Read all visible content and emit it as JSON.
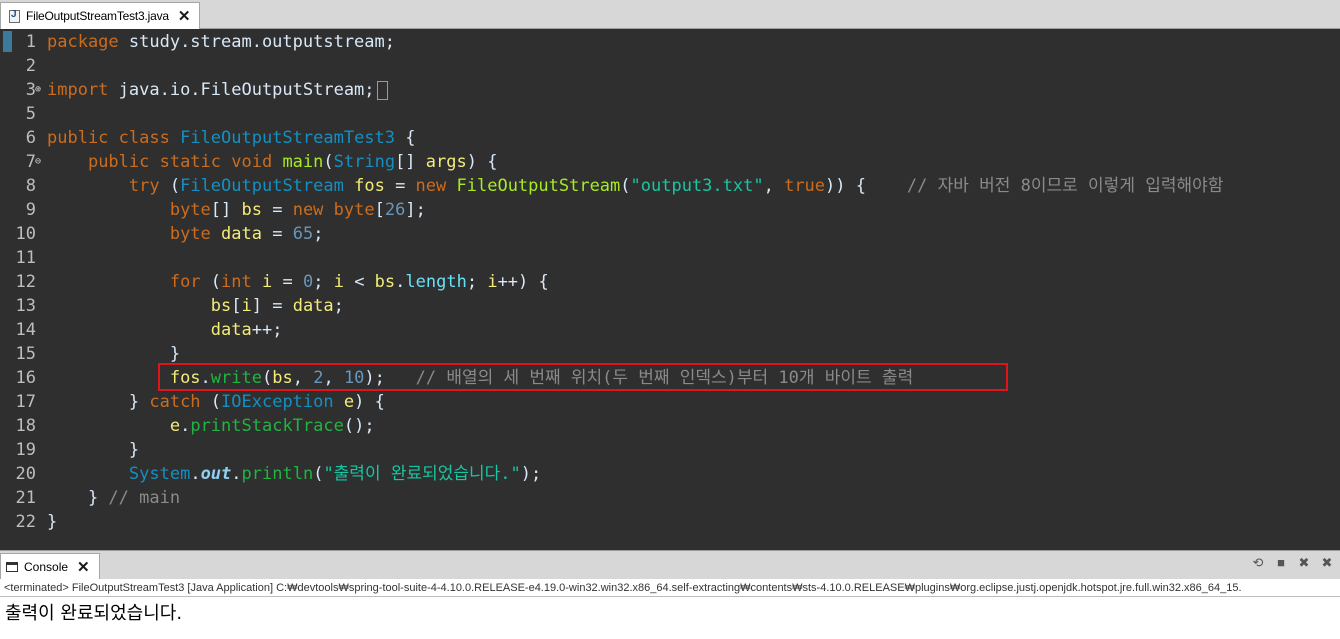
{
  "editor_tab": {
    "title": "FileOutputStreamTest3.java",
    "close": "✕",
    "icon": "java-file-icon"
  },
  "editor": {
    "lines": [
      {
        "n": "1",
        "fold": "",
        "segs": [
          {
            "t": "package",
            "c": "kw"
          },
          {
            "t": " study.stream.outputstream;"
          }
        ]
      },
      {
        "n": "2",
        "fold": "",
        "segs": []
      },
      {
        "n": "3",
        "fold": "⊕",
        "segs": [
          {
            "t": "import",
            "c": "kw"
          },
          {
            "t": " java.io.FileOutputStream;"
          },
          {
            "box": true
          }
        ]
      },
      {
        "n": "5",
        "fold": "",
        "segs": []
      },
      {
        "n": "6",
        "fold": "",
        "segs": [
          {
            "t": "public class",
            "c": "kw"
          },
          {
            "t": " "
          },
          {
            "t": "FileOutputStreamTest3",
            "c": "cls"
          },
          {
            "t": " {"
          }
        ]
      },
      {
        "n": "7",
        "fold": "⊖",
        "segs": [
          {
            "t": "    "
          },
          {
            "t": "public static void",
            "c": "kw"
          },
          {
            "t": " "
          },
          {
            "t": "main",
            "c": "fn"
          },
          {
            "t": "("
          },
          {
            "t": "String",
            "c": "cls"
          },
          {
            "t": "[] "
          },
          {
            "t": "args",
            "c": "var"
          },
          {
            "t": ") {"
          }
        ]
      },
      {
        "n": "8",
        "fold": "",
        "segs": [
          {
            "t": "        "
          },
          {
            "t": "try",
            "c": "kw"
          },
          {
            "t": " ("
          },
          {
            "t": "FileOutputStream",
            "c": "cls"
          },
          {
            "t": " "
          },
          {
            "t": "fos",
            "c": "var"
          },
          {
            "t": " = "
          },
          {
            "t": "new",
            "c": "kw"
          },
          {
            "t": " "
          },
          {
            "t": "FileOutputStream",
            "c": "fn"
          },
          {
            "t": "("
          },
          {
            "t": "\"output3.txt\"",
            "c": "str"
          },
          {
            "t": ", "
          },
          {
            "t": "true",
            "c": "kw"
          },
          {
            "t": ")) {    "
          },
          {
            "t": "// 자바 버전 8이므로 이렇게 입력해야함",
            "c": "cmt"
          }
        ]
      },
      {
        "n": "9",
        "fold": "",
        "segs": [
          {
            "t": "            "
          },
          {
            "t": "byte",
            "c": "kw"
          },
          {
            "t": "[] "
          },
          {
            "t": "bs",
            "c": "var"
          },
          {
            "t": " = "
          },
          {
            "t": "new",
            "c": "kw"
          },
          {
            "t": " "
          },
          {
            "t": "byte",
            "c": "kw"
          },
          {
            "t": "["
          },
          {
            "t": "26",
            "c": "num"
          },
          {
            "t": "];"
          }
        ]
      },
      {
        "n": "10",
        "fold": "",
        "segs": [
          {
            "t": "            "
          },
          {
            "t": "byte",
            "c": "kw"
          },
          {
            "t": " "
          },
          {
            "t": "data",
            "c": "var"
          },
          {
            "t": " = "
          },
          {
            "t": "65",
            "c": "num"
          },
          {
            "t": ";"
          }
        ]
      },
      {
        "n": "11",
        "fold": "",
        "segs": []
      },
      {
        "n": "12",
        "fold": "",
        "segs": [
          {
            "t": "            "
          },
          {
            "t": "for",
            "c": "kw"
          },
          {
            "t": " ("
          },
          {
            "t": "int",
            "c": "kw"
          },
          {
            "t": " "
          },
          {
            "t": "i",
            "c": "var"
          },
          {
            "t": " = "
          },
          {
            "t": "0",
            "c": "num"
          },
          {
            "t": "; "
          },
          {
            "t": "i",
            "c": "var"
          },
          {
            "t": " < "
          },
          {
            "t": "bs",
            "c": "var"
          },
          {
            "t": "."
          },
          {
            "t": "length",
            "c": "fld"
          },
          {
            "t": "; "
          },
          {
            "t": "i",
            "c": "var"
          },
          {
            "t": "++) {"
          }
        ]
      },
      {
        "n": "13",
        "fold": "",
        "segs": [
          {
            "t": "                "
          },
          {
            "t": "bs",
            "c": "var"
          },
          {
            "t": "["
          },
          {
            "t": "i",
            "c": "var"
          },
          {
            "t": "] = "
          },
          {
            "t": "data",
            "c": "var"
          },
          {
            "t": ";"
          }
        ]
      },
      {
        "n": "14",
        "fold": "",
        "segs": [
          {
            "t": "                "
          },
          {
            "t": "data",
            "c": "var"
          },
          {
            "t": "++;"
          }
        ]
      },
      {
        "n": "15",
        "fold": "",
        "segs": [
          {
            "t": "            }"
          }
        ]
      },
      {
        "n": "16",
        "fold": "",
        "segs": [
          {
            "t": "            "
          },
          {
            "t": "fos",
            "c": "var"
          },
          {
            "t": "."
          },
          {
            "t": "write",
            "c": "mth"
          },
          {
            "t": "("
          },
          {
            "t": "bs",
            "c": "var"
          },
          {
            "t": ", "
          },
          {
            "t": "2",
            "c": "num"
          },
          {
            "t": ", "
          },
          {
            "t": "10",
            "c": "num"
          },
          {
            "t": ");   "
          },
          {
            "t": "// 배열의 세 번째 위치(두 번째 인덱스)부터 10개 바이트 출력",
            "c": "cmt"
          }
        ]
      },
      {
        "n": "17",
        "fold": "",
        "segs": [
          {
            "t": "        } "
          },
          {
            "t": "catch",
            "c": "kw"
          },
          {
            "t": " ("
          },
          {
            "t": "IOException",
            "c": "cls"
          },
          {
            "t": " "
          },
          {
            "t": "e",
            "c": "var"
          },
          {
            "t": ") {"
          }
        ]
      },
      {
        "n": "18",
        "fold": "",
        "segs": [
          {
            "t": "            "
          },
          {
            "t": "e",
            "c": "var"
          },
          {
            "t": "."
          },
          {
            "t": "printStackTrace",
            "c": "mth"
          },
          {
            "t": "();"
          }
        ]
      },
      {
        "n": "19",
        "fold": "",
        "segs": [
          {
            "t": "        }"
          }
        ]
      },
      {
        "n": "20",
        "fold": "",
        "segs": [
          {
            "t": "        "
          },
          {
            "t": "System",
            "c": "cls"
          },
          {
            "t": "."
          },
          {
            "t": "out",
            "c": "sfld"
          },
          {
            "t": "."
          },
          {
            "t": "println",
            "c": "mth"
          },
          {
            "t": "("
          },
          {
            "t": "\"출력이 완료되었습니다.\"",
            "c": "str"
          },
          {
            "t": ");"
          }
        ]
      },
      {
        "n": "21",
        "fold": "",
        "segs": [
          {
            "t": "    } "
          },
          {
            "t": "// main",
            "c": "cmt"
          }
        ]
      },
      {
        "n": "22",
        "fold": "",
        "segs": [
          {
            "t": "}"
          }
        ]
      }
    ],
    "scroll_arrow": "<"
  },
  "console": {
    "tab_label": "Console",
    "close": "✕",
    "tools": [
      {
        "name": "pin-console-icon",
        "glyph": "⟲"
      },
      {
        "name": "terminate-icon",
        "glyph": "■"
      },
      {
        "name": "remove-launch-icon",
        "glyph": "✖"
      },
      {
        "name": "remove-all-icon",
        "glyph": "✖"
      }
    ],
    "status": "<terminated> FileOutputStreamTest3 [Java Application] C:₩devtools₩spring-tool-suite-4-4.10.0.RELEASE-e4.19.0-win32.win32.x86_64.self-extracting₩contents₩sts-4.10.0.RELEASE₩plugins₩org.eclipse.justj.openjdk.hotspot.jre.full.win32.x86_64_15.",
    "output": "출력이 완료되었습니다."
  },
  "colors": {
    "editor_bg": "#2f2f2f",
    "keyword": "#cc6c1d",
    "class": "#1290c3",
    "string": "#17c6a3",
    "comment": "#8a8a8a",
    "highlight_border": "#e0141c"
  }
}
